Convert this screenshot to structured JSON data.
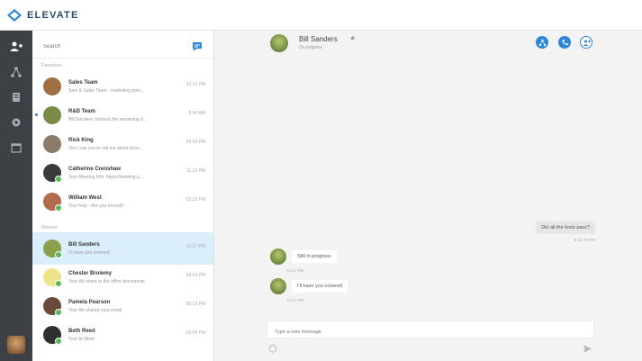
{
  "app": {
    "brand": "ELEVATE",
    "accent": "#2f86d6",
    "rail_bg": "#3d4146"
  },
  "search": {
    "placeholder": "Search"
  },
  "sections": {
    "favorites": "Favorites",
    "recent": "Recent"
  },
  "conversations": [
    {
      "name": "Sales Team",
      "preview": "Sam & Sales Team - marketing plan...",
      "time": "10:15 PM",
      "avatar": "#a07042"
    },
    {
      "name": "R&D Team",
      "preview": "Bill Sanders: recheck the remaining d...",
      "time": "8:40 AM",
      "avatar": "#7a8c4a",
      "unread": true
    },
    {
      "name": "Rick King",
      "preview": "Yes I can you to call me about price...",
      "time": "09:18 PM",
      "avatar": "#8a7a6a"
    },
    {
      "name": "Catherine Crenshaw",
      "preview": "Your Meeting Info: https://meeting.p...",
      "time": "11:19 PM",
      "avatar": "#3a3a3a"
    },
    {
      "name": "William West",
      "preview": "Your help - Are you around?",
      "time": "03:22 PM",
      "avatar": "#b26a4a"
    },
    {
      "name": "Bill Sanders",
      "preview": "I'll have you covered",
      "time": "10:17 PM",
      "avatar": "#8aa04a",
      "active": true
    },
    {
      "name": "Chester Brolemy",
      "preview": "Your file share to the office documents",
      "time": "09:14 PM",
      "avatar": "#f0e48a"
    },
    {
      "name": "Pamela Pearson",
      "preview": "Your file shared your email",
      "time": "09:13 PM",
      "avatar": "#6a4a3a"
    },
    {
      "name": "Beth Reed",
      "preview": "Your At Work",
      "time": "09:09 PM",
      "avatar": "#2f2f2f"
    }
  ],
  "chat": {
    "name": "Bill Sanders",
    "status": "On engines",
    "outgoing": {
      "text": "Did all the tests pass?",
      "meta": "10:17 PM"
    },
    "incoming": [
      {
        "text": "Still in progress",
        "meta": "10:17 PM"
      },
      {
        "text": "I'll have you covered",
        "meta": "10:17 PM"
      }
    ],
    "composer_placeholder": "Type a new message"
  }
}
